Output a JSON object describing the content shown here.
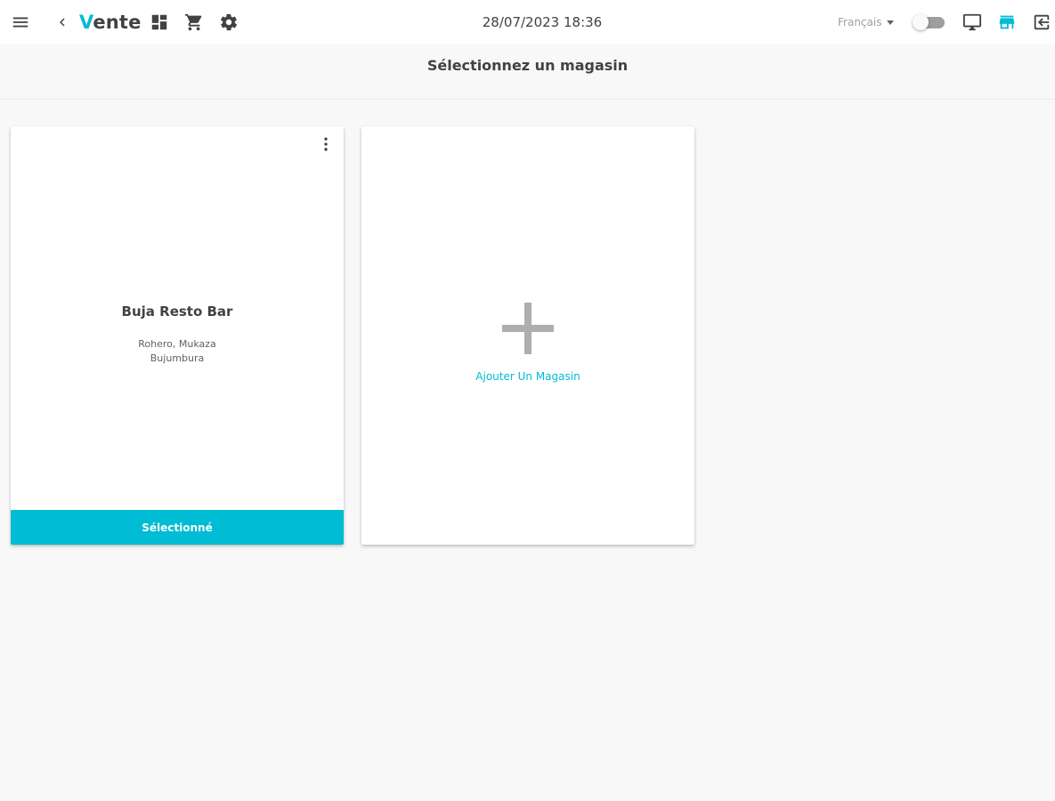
{
  "topbar": {
    "menu_icon": "hamburger-menu-icon",
    "back_icon": "chevron-left-icon",
    "title_accent": "V",
    "title_rest": "ente",
    "dashboard_icon": "dashboard-icon",
    "cart_icon": "shopping-cart-icon",
    "settings_icon": "gear-icon",
    "datetime": "28/07/2023 18:36",
    "language": "Français",
    "toggle_on": false,
    "display_icon": "monitor-icon",
    "store_icon": "storefront-icon",
    "logout_icon": "logout-icon"
  },
  "page": {
    "title": "Sélectionnez un magasin"
  },
  "stores": [
    {
      "name": "Buja Resto Bar",
      "address_line1": "Rohero, Mukaza",
      "address_line2": "Bujumbura",
      "button_label": "Sélectionné"
    }
  ],
  "add_store": {
    "label": "Ajouter Un Magasin",
    "icon": "plus-icon"
  },
  "colors": {
    "accent": "#00bcd4",
    "background": "#f8f8f8",
    "text": "#424242",
    "plus": "#aeaeae"
  }
}
